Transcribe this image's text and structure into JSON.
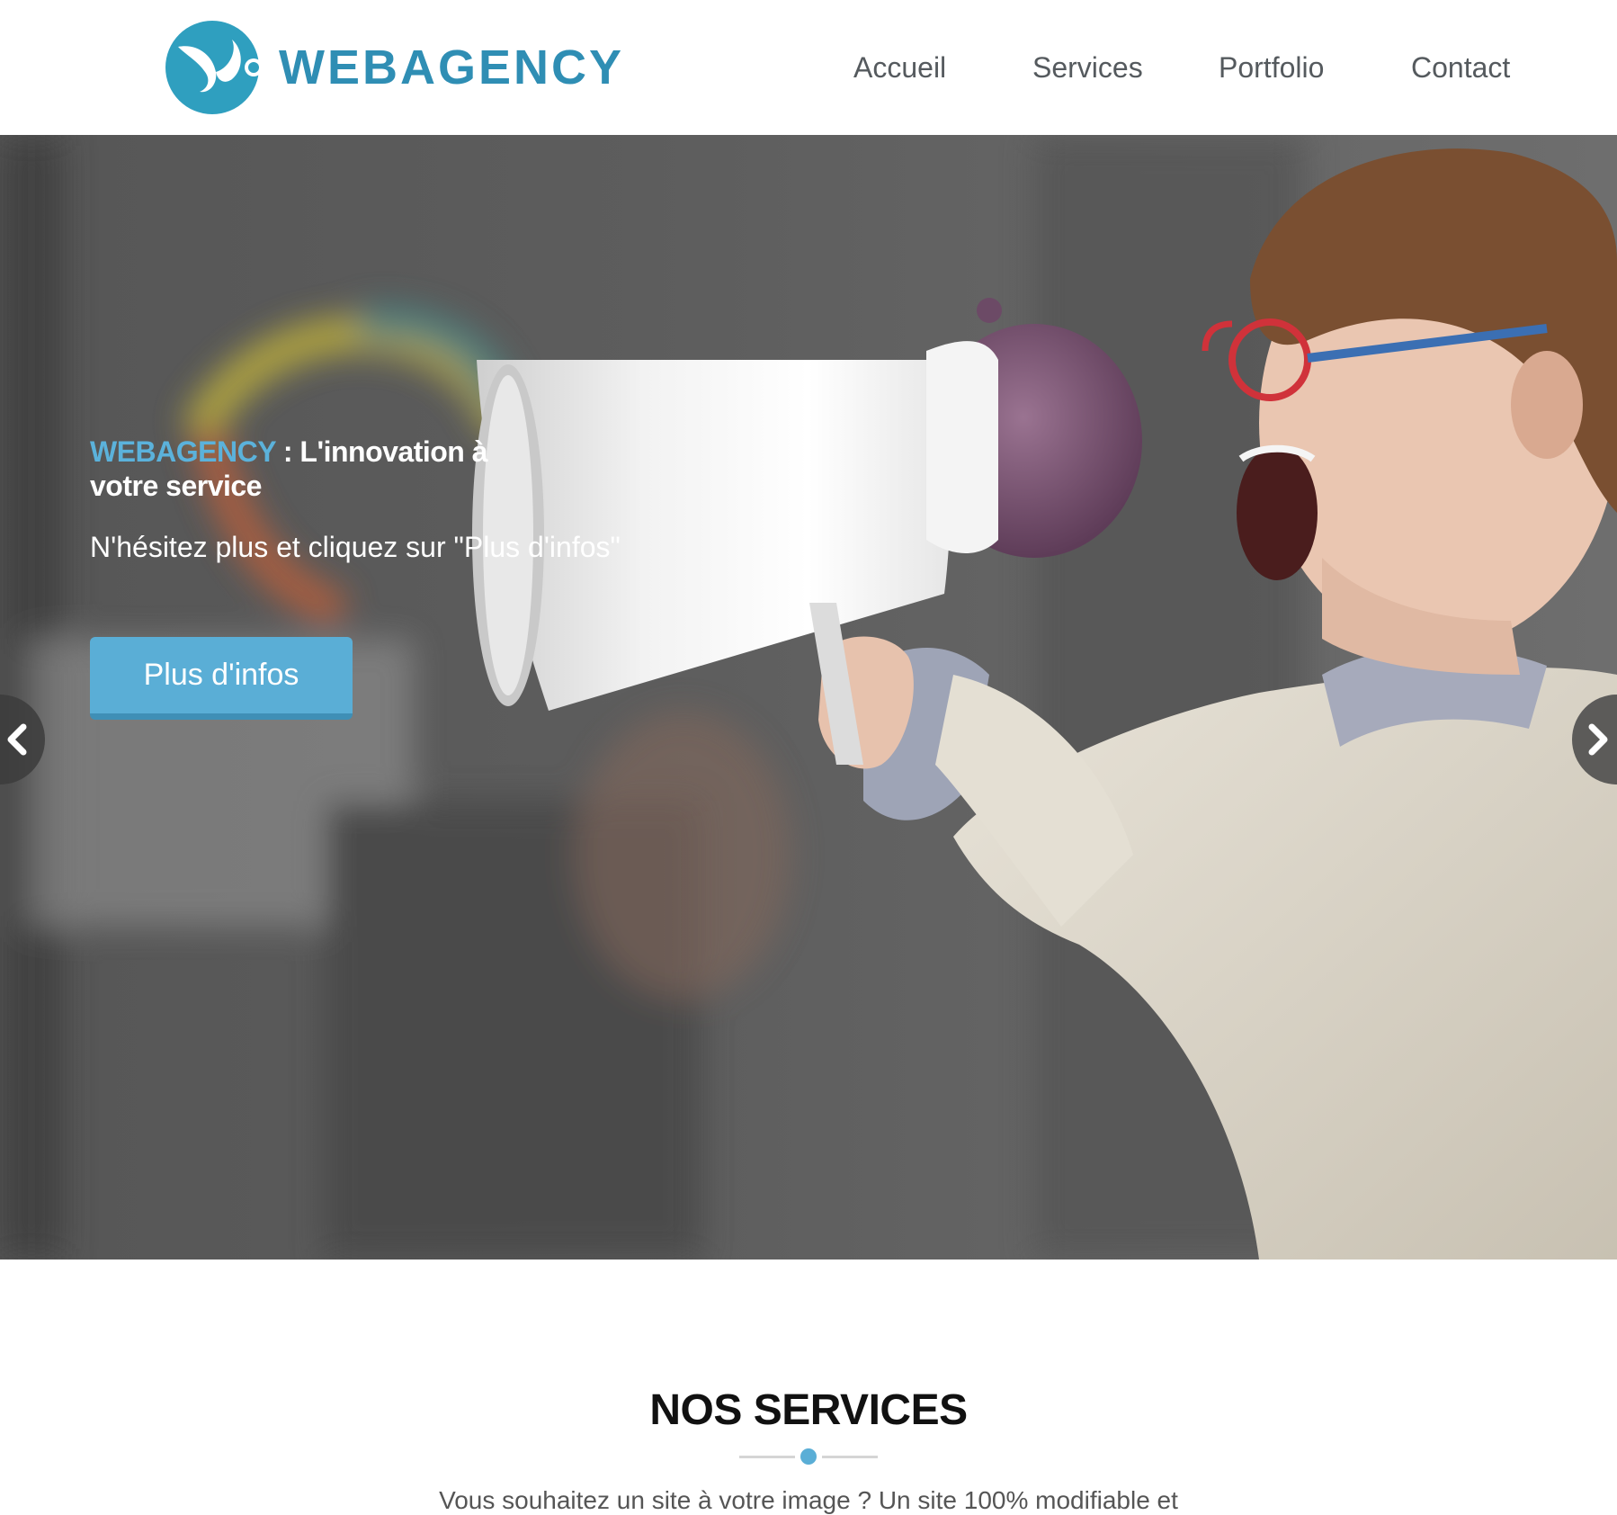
{
  "header": {
    "logo_text": "WEBAGENCY",
    "nav": [
      "Accueil",
      "Services",
      "Portfolio",
      "Contact"
    ]
  },
  "hero": {
    "title_brand": "WEBAGENCY",
    "title_rest": " : L'innovation à votre service",
    "subtitle": "N'hésitez plus et cliquez sur \"Plus d'infos\"",
    "button_label": "Plus d'infos",
    "prev_icon": "chevron-left-icon",
    "next_icon": "chevron-right-icon"
  },
  "services": {
    "title": "NOS SERVICES",
    "intro": "Vous souhaitez un site à votre image ? Un site 100% modifiable et"
  },
  "colors": {
    "brand": "#2f8eb4",
    "accent": "#5aaed6"
  }
}
